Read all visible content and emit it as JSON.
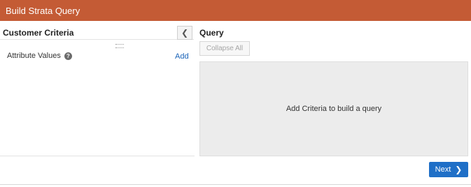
{
  "header": {
    "title": "Build Strata Query"
  },
  "left_panel": {
    "title": "Customer Criteria",
    "attribute_label": "Attribute Values",
    "help_icon": "help-icon",
    "add_label": "Add"
  },
  "right_panel": {
    "title": "Query",
    "collapse_all_label": "Collapse All",
    "empty_message": "Add Criteria to build a query"
  },
  "footer": {
    "next_label": "Next"
  },
  "colors": {
    "header_bg": "#c45b35",
    "primary_button": "#1f6fc7",
    "link": "#1a63b8"
  }
}
